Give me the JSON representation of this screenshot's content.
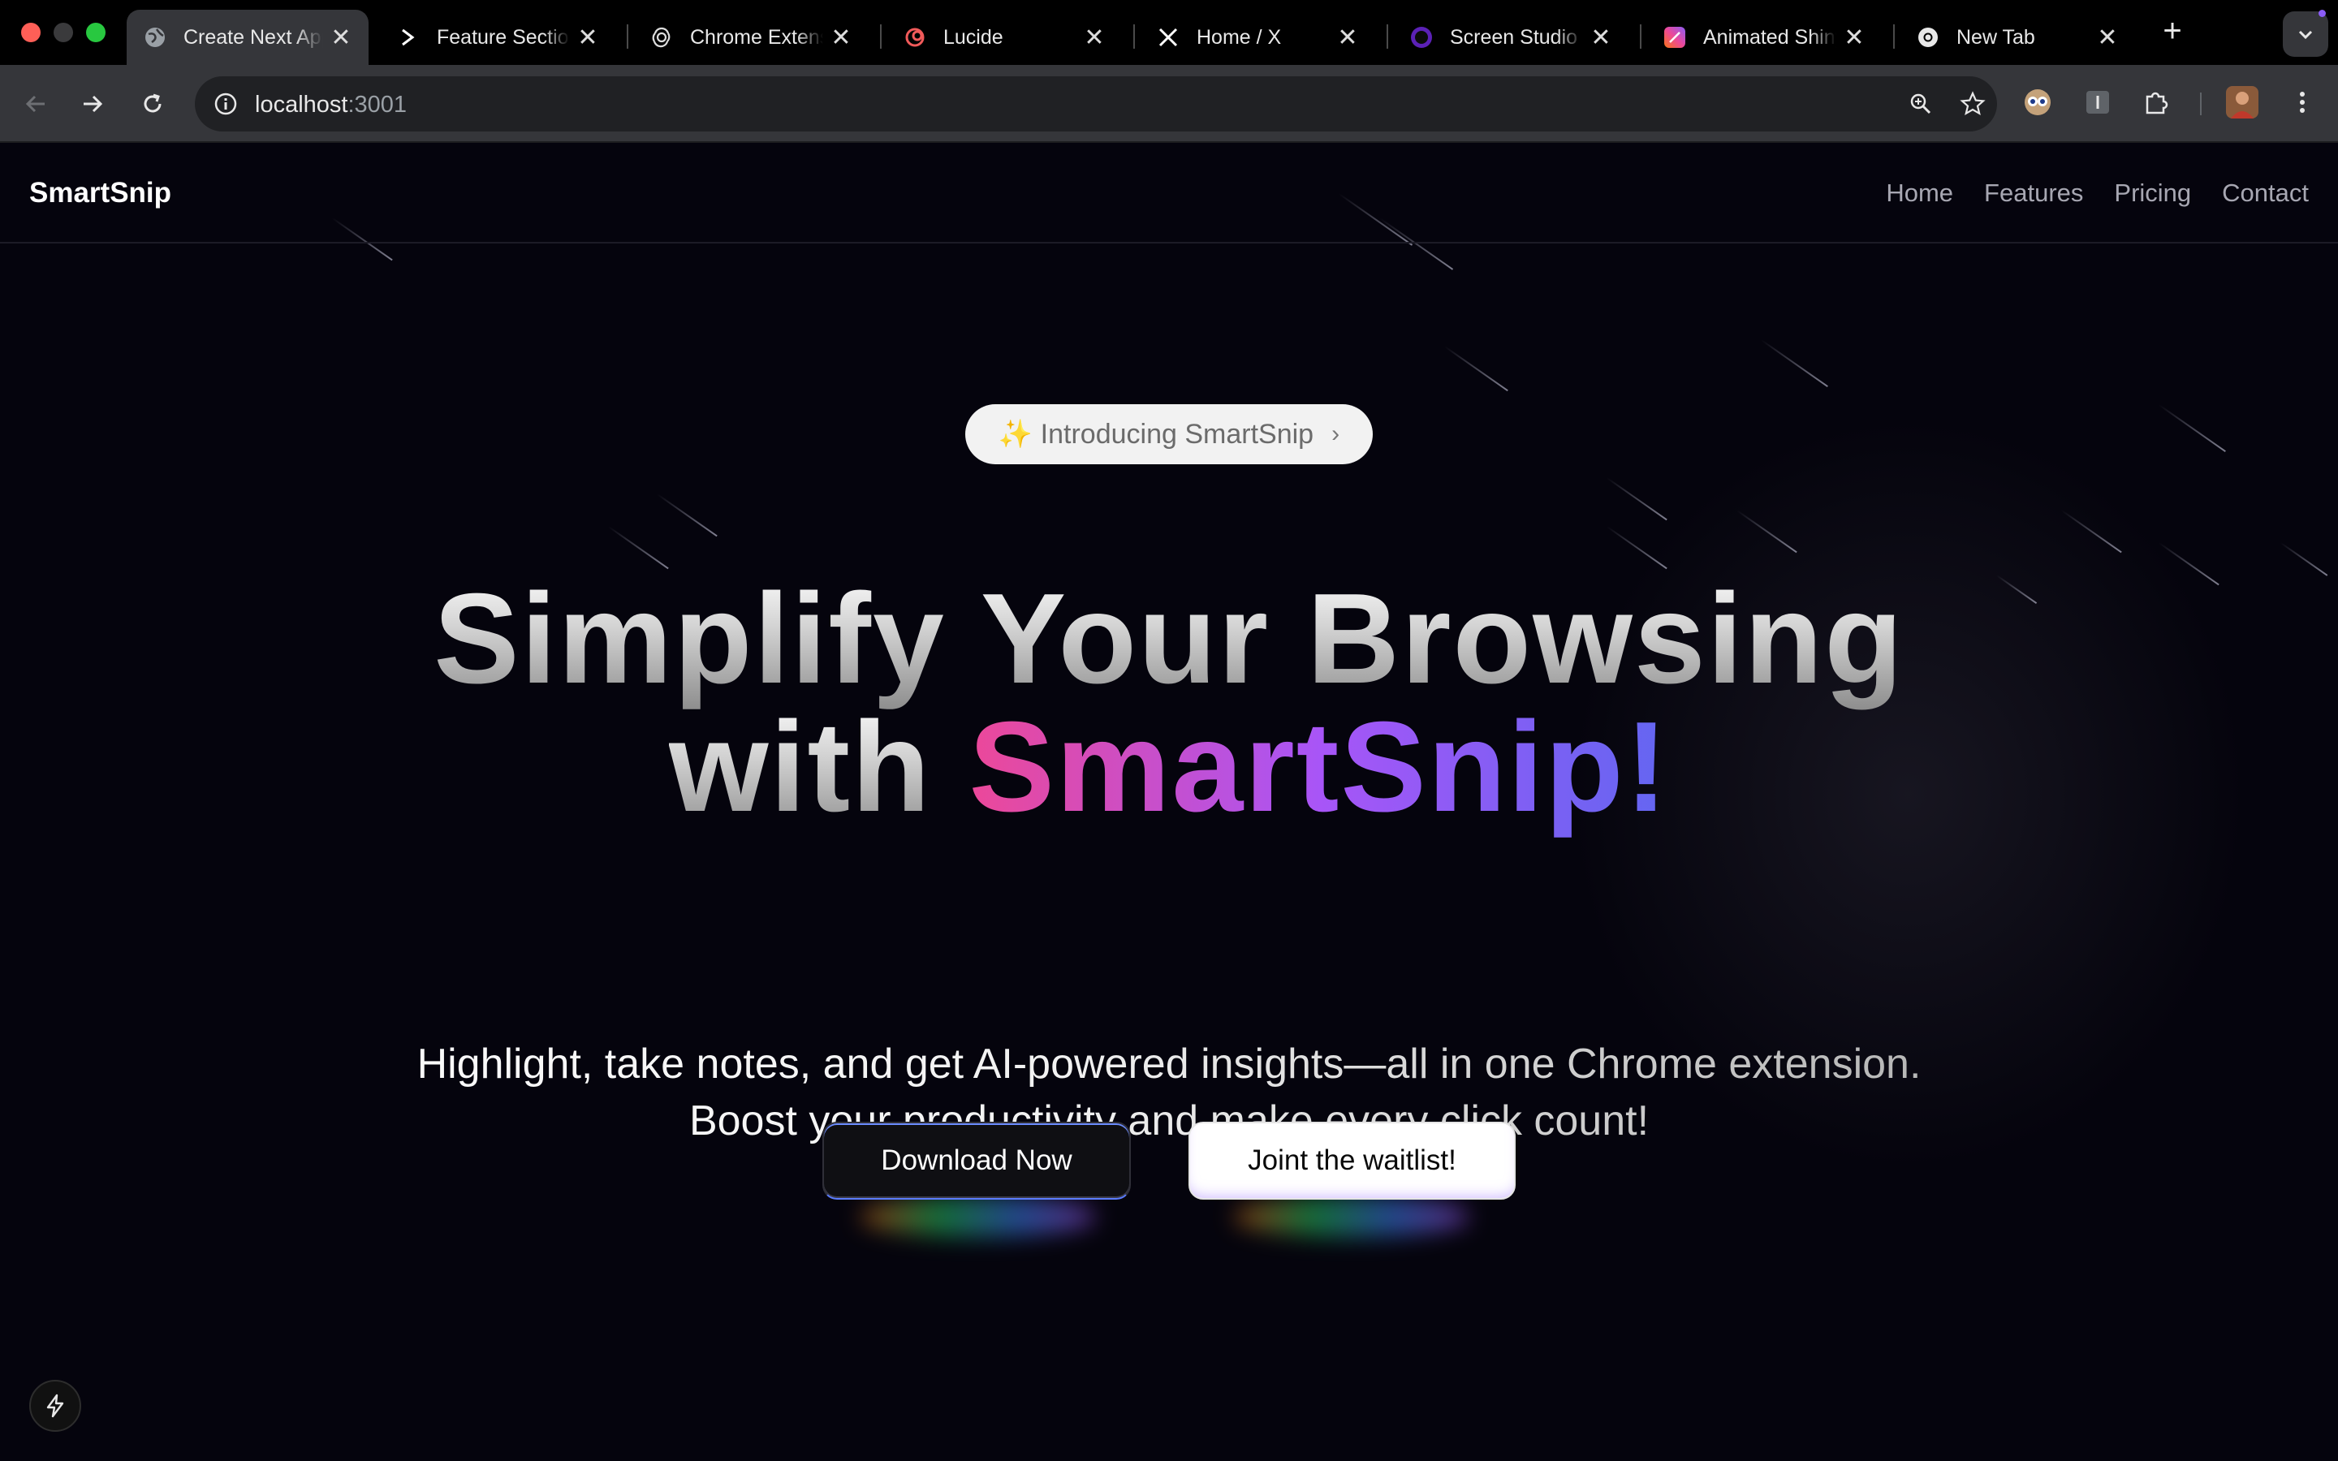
{
  "browser": {
    "tabs": [
      {
        "title": "Create Next App",
        "icon": "globe-icon",
        "active": true
      },
      {
        "title": "Feature Sections",
        "icon": "chevron-right-icon",
        "active": false
      },
      {
        "title": "Chrome Extension",
        "icon": "openai-icon",
        "active": false
      },
      {
        "title": "Lucide",
        "icon": "lucide-icon",
        "active": false
      },
      {
        "title": "Home / X",
        "icon": "x-logo-icon",
        "active": false
      },
      {
        "title": "Screen Studio",
        "icon": "screen-studio-icon",
        "active": false
      },
      {
        "title": "Animated Shiny",
        "icon": "gradient-app-icon",
        "active": false
      },
      {
        "title": "New Tab",
        "icon": "chrome-icon",
        "active": false
      }
    ],
    "close_glyph": "✕",
    "new_tab_glyph": "+",
    "url_host": "localhost",
    "url_port": ":3001"
  },
  "site": {
    "logo": "SmartSnip",
    "nav": [
      "Home",
      "Features",
      "Pricing",
      "Contact"
    ],
    "intro_badge": "✨ Introducing SmartSnip",
    "intro_chevron": "›",
    "headline_line1": "Simplify Your Browsing",
    "headline_with": "with ",
    "headline_brand": "SmartSnip!",
    "subtitle_line1": "Highlight, take notes, and get AI-powered insights—all in one Chrome extension.",
    "subtitle_line2": "Boost your productivity and make every click count!",
    "cta_primary": "Download Now",
    "cta_secondary": "Joint the waitlist!"
  },
  "colors": {
    "brand_gradient": [
      "#ec4899",
      "#a855f7",
      "#6366f1"
    ],
    "background": "#05040d"
  }
}
